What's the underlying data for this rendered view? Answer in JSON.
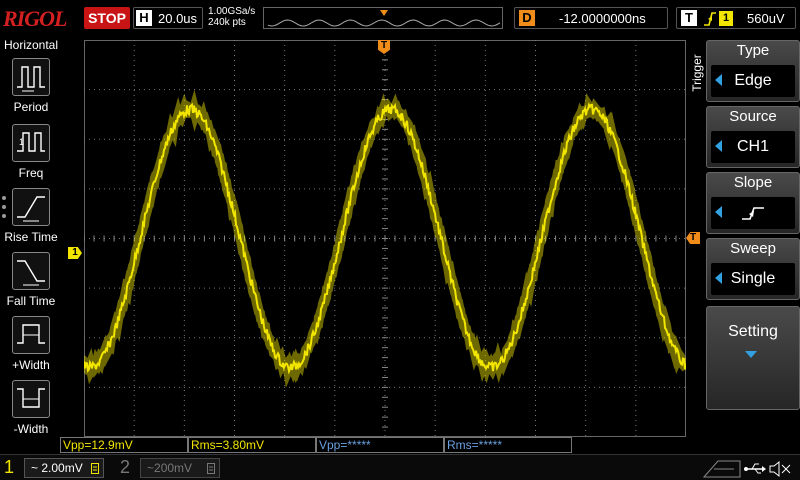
{
  "header": {
    "brand": "RIGOL",
    "run_state": "STOP",
    "horizontal_tag": "H",
    "timebase": "20.0us",
    "sample_rate": "1.00GSa/s",
    "memory_depth": "240k pts",
    "delay_tag": "D",
    "delay_value": "-12.0000000ns",
    "trigger_tag": "T",
    "trigger_channel": "1",
    "trigger_level": "560uV"
  },
  "sidebar": {
    "title": "Horizontal",
    "items": [
      {
        "label": "Period",
        "icon": "period-icon"
      },
      {
        "label": "Freq",
        "icon": "frequency-icon"
      },
      {
        "label": "Rise Time",
        "icon": "rise-time-icon"
      },
      {
        "label": "Fall Time",
        "icon": "fall-time-icon"
      },
      {
        "label": "+Width",
        "icon": "positive-width-icon"
      },
      {
        "label": "-Width",
        "icon": "negative-width-icon"
      }
    ]
  },
  "trigger_menu": {
    "title": "Trigger",
    "items": [
      {
        "title": "Type",
        "value": "Edge"
      },
      {
        "title": "Source",
        "value": "CH1"
      },
      {
        "title": "Slope",
        "value": "",
        "icon": "rising-edge-icon"
      },
      {
        "title": "Sweep",
        "value": "Single"
      }
    ],
    "setting": "Setting"
  },
  "measurements": [
    {
      "text": "Vpp=12.9mV",
      "channel": "1"
    },
    {
      "text": "Rms=3.80mV",
      "channel": "1"
    },
    {
      "text": "Vpp=*****",
      "channel": "off"
    },
    {
      "text": "Rms=*****",
      "channel": "off"
    }
  ],
  "channels": [
    {
      "number": "1",
      "scale": "2.00mV",
      "coupling": "~",
      "active": true
    },
    {
      "number": "2",
      "scale": "200mV",
      "coupling": "~",
      "active": false
    }
  ],
  "markers": {
    "ground_ch1": "1",
    "trigger_position": "T",
    "trigger_level": "T"
  },
  "colors": {
    "ch1": "#f2e600",
    "trigger": "#f08c1a",
    "stop": "#c81414",
    "menu_arrow": "#33a0e0"
  },
  "waveform": {
    "type": "sine",
    "amplitude_div": 2.6,
    "period_us": 80,
    "phase_deg": 0,
    "grid_divisions": {
      "h": 12,
      "v": 8
    }
  }
}
